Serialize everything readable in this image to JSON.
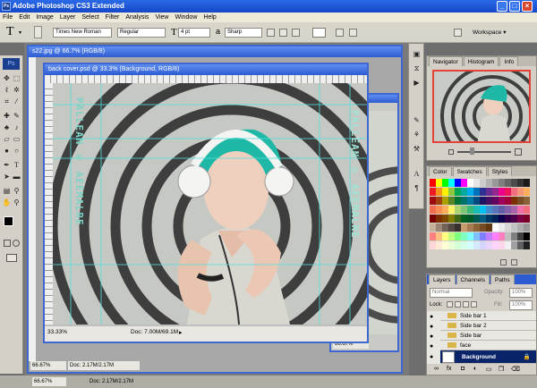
{
  "app": {
    "title": "Adobe Photoshop CS3 Extended",
    "logo": "Ps"
  },
  "window_controls": {
    "min_glyph": "_",
    "max_glyph": "□",
    "close_glyph": "×"
  },
  "menu": [
    "File",
    "Edit",
    "Image",
    "Layer",
    "Select",
    "Filter",
    "Analysis",
    "View",
    "Window",
    "Help"
  ],
  "options_bar": {
    "tool_glyph": "T",
    "font_family": "Times New Roman",
    "font_style": "Regular",
    "size_glyph": "T",
    "font_size": "4 pt",
    "aa_label": "a",
    "aa_mode": "Sharp",
    "workspace": "Workspace ▾"
  },
  "documents": {
    "back": {
      "title": "s22.jpg @ 66.7% (RGB/8)",
      "zoom": "66.67%",
      "doc_info": "Doc: 2.17M/2.17M"
    },
    "front": {
      "title": "back cover.psd @ 33.3% (Background, RGB/8)",
      "zoom": "33.33%",
      "doc_info": "Doc: 7.00M/69.1M",
      "side_text_left": "PALLEAN © AEEMALRE",
      "side_text_right": "PALLEAN © AEEMALRE"
    },
    "third": {
      "zoom": "66.67%"
    }
  },
  "panels": {
    "navigator_group": {
      "tabs": [
        "Navigator",
        "Histogram",
        "Info"
      ],
      "active": 0
    },
    "swatches_group": {
      "tabs": [
        "Color",
        "Swatches",
        "Styles"
      ],
      "active": 1
    },
    "layers_group": {
      "tabs": [
        "Layers",
        "Channels",
        "Paths"
      ],
      "active": 0,
      "blend_mode": "Normal",
      "opacity_label": "Opacity:",
      "opacity": "100%",
      "lock_label": "Lock:",
      "fill_label": "Fill:",
      "fill": "100%",
      "layers": [
        {
          "name": "Side bar 1",
          "type": "group"
        },
        {
          "name": "Side bar 2",
          "type": "group"
        },
        {
          "name": "Side bar",
          "type": "group"
        },
        {
          "name": "face",
          "type": "group"
        },
        {
          "name": "Background",
          "type": "pixel",
          "selected": true
        }
      ]
    }
  },
  "colors": {
    "accent": "#2d5bd1",
    "selection": "#0a246a",
    "foreground": "#000000",
    "background": "#ffffff"
  },
  "swatch_rows": [
    [
      "#ff0000",
      "#ffff00",
      "#00ff00",
      "#00ffff",
      "#0000ff",
      "#ff00ff",
      "#ffffff",
      "#e5e5e5",
      "#cccccc",
      "#b2b2b2",
      "#999999",
      "#7f7f7f",
      "#666666",
      "#4c4c4c",
      "#333333",
      "#191919"
    ],
    [
      "#ed1c24",
      "#f7941d",
      "#fff200",
      "#8dc63f",
      "#00a651",
      "#00a99d",
      "#00aeef",
      "#0072bc",
      "#2e3192",
      "#662d91",
      "#92278f",
      "#ec008c",
      "#ed145b",
      "#f26d7d",
      "#f69679",
      "#fbaf5d"
    ],
    [
      "#9e0b0f",
      "#a0410d",
      "#aba000",
      "#598527",
      "#007236",
      "#00746b",
      "#0076a3",
      "#004a80",
      "#1b1464",
      "#440e62",
      "#630460",
      "#9e005d",
      "#9e0039",
      "#7b2e00",
      "#754c24",
      "#8c6239"
    ],
    [
      "#f26c4f",
      "#f68e56",
      "#fbaf5c",
      "#fff467",
      "#acd372",
      "#7cc576",
      "#3bb878",
      "#1abbb4",
      "#00bff3",
      "#438ccb",
      "#5574b9",
      "#605ca8",
      "#8560a8",
      "#a864a8",
      "#f06eaa",
      "#f26d7d"
    ],
    [
      "#790000",
      "#7b2e00",
      "#7d4900",
      "#827b00",
      "#406618",
      "#005e20",
      "#005826",
      "#005952",
      "#005b7f",
      "#003663",
      "#002157",
      "#0d004c",
      "#32004b",
      "#4b0049",
      "#7b0046",
      "#7a0026"
    ],
    [
      "#c7b299",
      "#998675",
      "#736357",
      "#534741",
      "#37302d",
      "#c69c6d",
      "#a67c52",
      "#8c6239",
      "#754c24",
      "#603913",
      "#ffffff",
      "#ebebeb",
      "#d6d6d6",
      "#c2c2c2",
      "#adadad",
      "#999999"
    ],
    [
      "#ff8080",
      "#ffc080",
      "#ffff80",
      "#c0ff80",
      "#80ff80",
      "#80ffc0",
      "#80ffff",
      "#80c0ff",
      "#8080ff",
      "#c080ff",
      "#ff80ff",
      "#ff80c0",
      "#c0c0c0",
      "#808080",
      "#404040",
      "#000000"
    ],
    [
      "#ffd5d5",
      "#ffead5",
      "#ffffd5",
      "#eaffd5",
      "#d5ffd5",
      "#d5ffea",
      "#d5ffff",
      "#d5eaff",
      "#d5d5ff",
      "#ead5ff",
      "#ffd5ff",
      "#ffd5ea",
      "#f0f0f0",
      "#a0a0a0",
      "#606060",
      "#202020"
    ]
  ]
}
